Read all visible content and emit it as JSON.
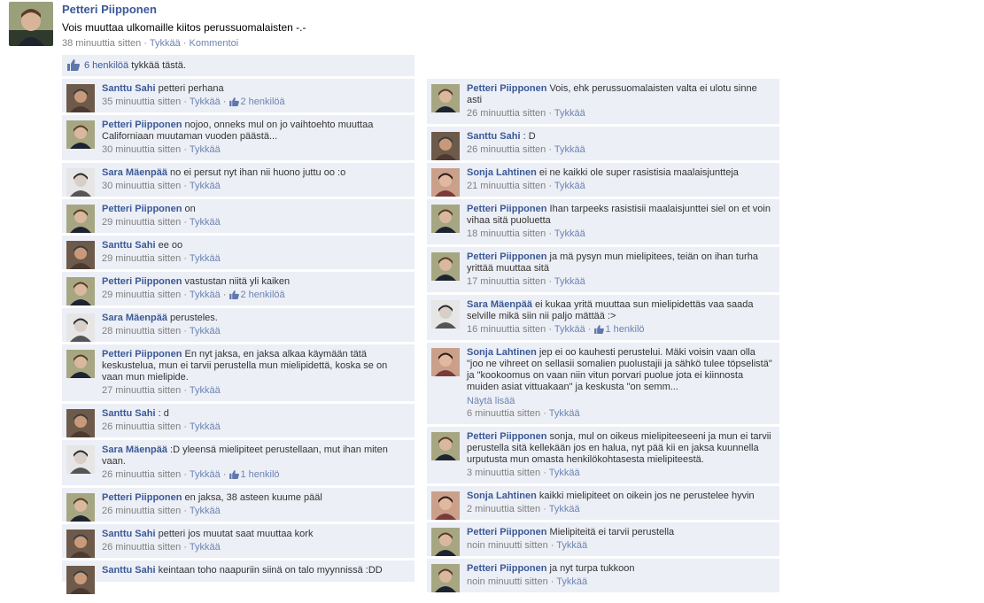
{
  "post": {
    "author": "Petteri Piipponen",
    "text": "Vois muuttaa ulkomaille kiitos perussuomalaisten -.-",
    "time": "38 minuuttia sitten",
    "like_label": "Tykkää",
    "comment_label": "Kommentoi",
    "likes_count": "6 henkilöä",
    "likes_suffix": "tykkää tästä."
  },
  "comments_left": [
    {
      "author": "Santtu Sahi",
      "text": "petteri perhana",
      "time": "35 minuuttia sitten",
      "like": "Tykkää",
      "likes": "2 henkilöä",
      "avatar": "santtu"
    },
    {
      "author": "Petteri Piipponen",
      "text": "nojoo, onneks mul on jo vaihtoehto muuttaa Californiaan muutaman vuoden päästä...",
      "time": "30 minuuttia sitten",
      "like": "Tykkää",
      "avatar": "petteri"
    },
    {
      "author": "Sara Mäenpää",
      "text": "no ei persut nyt ihan nii huono juttu oo :o",
      "time": "30 minuuttia sitten",
      "like": "Tykkää",
      "avatar": "sara"
    },
    {
      "author": "Petteri Piipponen",
      "text": "on",
      "time": "29 minuuttia sitten",
      "like": "Tykkää",
      "avatar": "petteri"
    },
    {
      "author": "Santtu Sahi",
      "text": "ee oo",
      "time": "29 minuuttia sitten",
      "like": "Tykkää",
      "avatar": "santtu"
    },
    {
      "author": "Petteri Piipponen",
      "text": "vastustan niitä yli kaiken",
      "time": "29 minuuttia sitten",
      "like": "Tykkää",
      "likes": "2 henkilöä",
      "avatar": "petteri"
    },
    {
      "author": "Sara Mäenpää",
      "text": "perusteles.",
      "time": "28 minuuttia sitten",
      "like": "Tykkää",
      "avatar": "sara"
    },
    {
      "author": "Petteri Piipponen",
      "text": "En nyt jaksa, en jaksa alkaa käymään tätä keskustelua, mun ei tarvii perustella mun mielipidettä, koska se on vaan mun mielipide.",
      "time": "27 minuuttia sitten",
      "like": "Tykkää",
      "avatar": "petteri"
    },
    {
      "author": "Santtu Sahi",
      "text": ": d",
      "time": "26 minuuttia sitten",
      "like": "Tykkää",
      "avatar": "santtu"
    },
    {
      "author": "Sara Mäenpää",
      "text": ":D yleensä mielipiteet perustellaan, mut ihan miten vaan.",
      "time": "26 minuuttia sitten",
      "like": "Tykkää",
      "likes": "1 henkilö",
      "avatar": "sara"
    },
    {
      "author": "Petteri Piipponen",
      "text": "en jaksa, 38 asteen kuume pääl",
      "time": "26 minuuttia sitten",
      "like": "Tykkää",
      "avatar": "petteri"
    },
    {
      "author": "Santtu Sahi",
      "text": "petteri jos muutat saat muuttaa kork",
      "time": "26 minuuttia sitten",
      "like": "Tykkää",
      "avatar": "santtu"
    },
    {
      "author": "Santtu Sahi",
      "text": "keintaan toho naapuriin siinä on talo myynnissä :DD",
      "time": "",
      "like": "",
      "avatar": "santtu"
    }
  ],
  "comments_right": [
    {
      "author": "Petteri Piipponen",
      "text": "Vois, ehk perussuomalaisten valta ei ulotu sinne asti",
      "time": "26 minuuttia sitten",
      "like": "Tykkää",
      "avatar": "petteri"
    },
    {
      "author": "Santtu Sahi",
      "text": ": D",
      "time": "26 minuuttia sitten",
      "like": "Tykkää",
      "avatar": "santtu"
    },
    {
      "author": "Sonja Lahtinen",
      "text": "ei ne kaikki ole super rasistisia maalaisjuntteja",
      "time": "21 minuuttia sitten",
      "like": "Tykkää",
      "avatar": "sonja"
    },
    {
      "author": "Petteri Piipponen",
      "text": "Ihan tarpeeks rasistisii maalaisjunttei siel on et voin vihaa sitä puoluetta",
      "time": "18 minuuttia sitten",
      "like": "Tykkää",
      "avatar": "petteri"
    },
    {
      "author": "Petteri Piipponen",
      "text": "ja mä pysyn mun mielipitees, teiän on ihan turha yrittää muuttaa sitä",
      "time": "17 minuuttia sitten",
      "like": "Tykkää",
      "avatar": "petteri"
    },
    {
      "author": "Sara Mäenpää",
      "text": "ei kukaa yritä muuttaa sun mielipidettäs vaa saada selville mikä siin nii paljo mättää :>",
      "time": "16 minuuttia sitten",
      "like": "Tykkää",
      "likes": "1 henkilö",
      "avatar": "sara"
    },
    {
      "author": "Sonja Lahtinen",
      "text": "jep ei oo kauhesti perustelui. Mäki voisin vaan olla \"joo ne vihreet on sellasii somalien puolustajii ja sähkö tulee töpselistä\" ja \"kookoomus on vaan niin vitun porvari puolue jota ei kiinnosta muiden asiat vittuakaan\" ja keskusta \"on semm...",
      "more": "Näytä lisää",
      "time": "6 minuuttia sitten",
      "like": "Tykkää",
      "avatar": "sonja"
    },
    {
      "author": "Petteri Piipponen",
      "text": "sonja, mul on oikeus mielipiteeseeni ja mun ei tarvii perustella sitä kellekään jos en halua, nyt pää kii en jaksa kuunnella urputusta mun omasta henkilökohtasesta mielipiteestä.",
      "time": "3 minuuttia sitten",
      "like": "Tykkää",
      "avatar": "petteri"
    },
    {
      "author": "Sonja Lahtinen",
      "text": "kaikki mielipiteet on oikein jos ne perustelee hyvin",
      "time": "2 minuuttia sitten",
      "like": "Tykkää",
      "avatar": "sonja"
    },
    {
      "author": "Petteri Piipponen",
      "text": "Mielipiteitä ei tarvii perustella",
      "time": "noin minuutti sitten",
      "like": "Tykkää",
      "avatar": "petteri"
    },
    {
      "author": "Petteri Piipponen",
      "text": "ja nyt turpa tukkoon",
      "time": "noin minuutti sitten",
      "like": "Tykkää",
      "avatar": "petteri"
    }
  ],
  "colors": {
    "link": "#3b5998",
    "bar": "#eceff5",
    "meta": "#808080"
  }
}
